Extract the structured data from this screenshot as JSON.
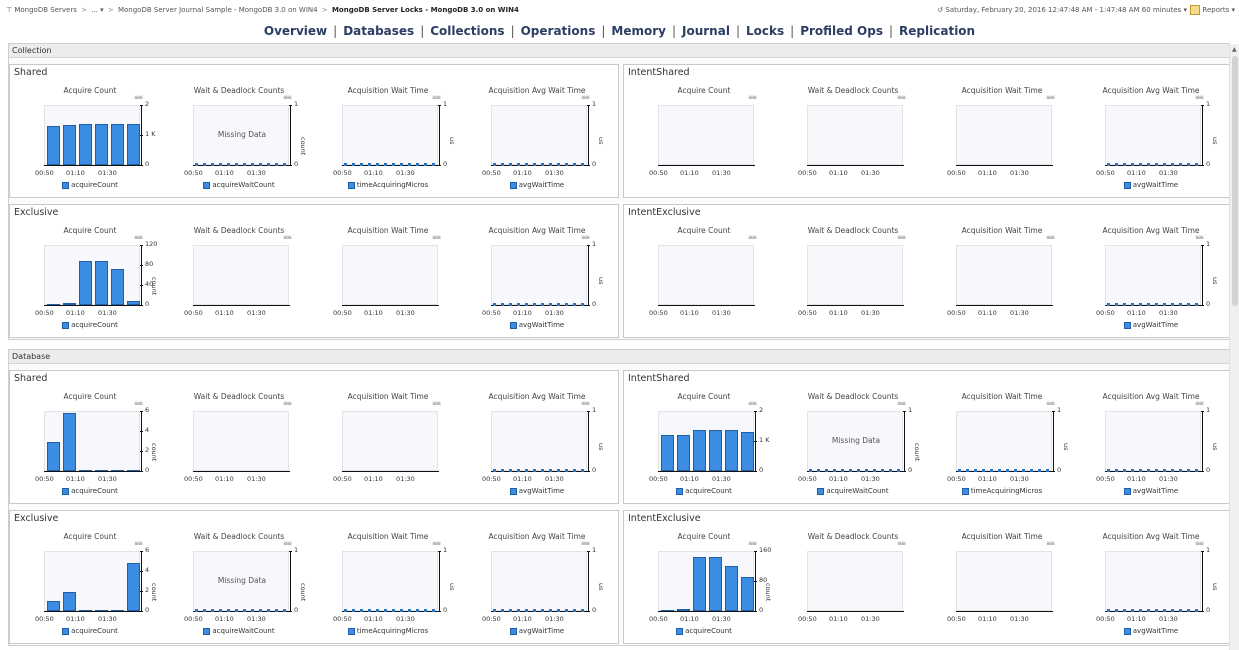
{
  "topbar": {
    "breadcrumb": [
      {
        "label": "MongoDB Servers"
      },
      {
        "label": "..."
      },
      {
        "label": "MongoDB Server Journal Sample - MongoDB 3.0 on WIN4"
      },
      {
        "label": "MongoDB Server Locks - MongoDB 3.0 on WIN4"
      }
    ],
    "time_range": "Saturday, February 20, 2016 12:47:48 AM - 1:47:48 AM 60 minutes",
    "reports_label": "Reports"
  },
  "nav": [
    {
      "label": "Overview"
    },
    {
      "label": "Databases"
    },
    {
      "label": "Collections"
    },
    {
      "label": "Operations"
    },
    {
      "label": "Memory"
    },
    {
      "label": "Journal"
    },
    {
      "label": "Locks"
    },
    {
      "label": "Profiled Ops"
    },
    {
      "label": "Replication"
    }
  ],
  "x_tick_labels": [
    "00:50",
    "01:10",
    "01:30"
  ],
  "sections": [
    {
      "title": "Collection",
      "panels": [
        {
          "title": "Shared",
          "charts": [
            {
              "title": "Acquire Count",
              "mode": "bars",
              "y_ticks": [
                "2",
                "1 K",
                "0"
              ],
              "ylim": [
                0,
                2000
              ],
              "values": [
                1350,
                1380,
                1400,
                1400,
                1400,
                1400
              ],
              "legend": "acquireCount"
            },
            {
              "title": "Wait & Deadlock Counts",
              "mode": "flat",
              "missing": "Missing Data",
              "y_ticks": [
                "1",
                "0"
              ],
              "ylabel": "count",
              "legend": "acquireWaitCount"
            },
            {
              "title": "Acquisition Wait Time",
              "mode": "flat",
              "y_ticks": [
                "1",
                "0"
              ],
              "ylabel": "us",
              "legend": "timeAcquiringMicros"
            },
            {
              "title": "Acquisition Avg Wait Time",
              "mode": "flat",
              "y_ticks": [
                "1",
                "0"
              ],
              "ylabel": "us",
              "legend": "avgWaitTime"
            }
          ]
        },
        {
          "title": "IntentShared",
          "charts": [
            {
              "title": "Acquire Count",
              "mode": "empty",
              "y_ticks": []
            },
            {
              "title": "Wait & Deadlock Counts",
              "mode": "empty",
              "y_ticks": []
            },
            {
              "title": "Acquisition Wait Time",
              "mode": "empty",
              "y_ticks": []
            },
            {
              "title": "Acquisition Avg Wait Time",
              "mode": "flat",
              "y_ticks": [
                "1",
                "0"
              ],
              "ylabel": "us",
              "legend": "avgWaitTime"
            }
          ]
        },
        {
          "title": "Exclusive",
          "charts": [
            {
              "title": "Acquire Count",
              "mode": "bars",
              "y_ticks": [
                "120",
                "80",
                "40",
                "0"
              ],
              "ylim": [
                0,
                120
              ],
              "values": [
                3,
                5,
                90,
                90,
                75,
                8
              ],
              "ylabel": "count",
              "legend": "acquireCount"
            },
            {
              "title": "Wait & Deadlock Counts",
              "mode": "empty",
              "y_ticks": []
            },
            {
              "title": "Acquisition Wait Time",
              "mode": "empty",
              "y_ticks": []
            },
            {
              "title": "Acquisition Avg Wait Time",
              "mode": "flat",
              "y_ticks": [
                "1",
                "0"
              ],
              "ylabel": "us",
              "legend": "avgWaitTime"
            }
          ]
        },
        {
          "title": "IntentExclusive",
          "charts": [
            {
              "title": "Acquire Count",
              "mode": "empty",
              "y_ticks": []
            },
            {
              "title": "Wait & Deadlock Counts",
              "mode": "empty",
              "y_ticks": []
            },
            {
              "title": "Acquisition Wait Time",
              "mode": "empty",
              "y_ticks": []
            },
            {
              "title": "Acquisition Avg Wait Time",
              "mode": "flat",
              "y_ticks": [
                "1",
                "0"
              ],
              "ylabel": "us",
              "legend": "avgWaitTime"
            }
          ]
        }
      ]
    },
    {
      "title": "Database",
      "panels": [
        {
          "title": "Shared",
          "charts": [
            {
              "title": "Acquire Count",
              "mode": "bars",
              "y_ticks": [
                "6",
                "4",
                "2",
                "0"
              ],
              "ylim": [
                0,
                6
              ],
              "values": [
                3,
                6,
                0,
                0,
                0,
                0
              ],
              "ylabel": "count",
              "legend": "acquireCount"
            },
            {
              "title": "Wait & Deadlock Counts",
              "mode": "empty",
              "y_ticks": []
            },
            {
              "title": "Acquisition Wait Time",
              "mode": "empty",
              "y_ticks": []
            },
            {
              "title": "Acquisition Avg Wait Time",
              "mode": "flat",
              "y_ticks": [
                "1",
                "0"
              ],
              "ylabel": "us",
              "legend": "avgWaitTime"
            }
          ]
        },
        {
          "title": "IntentShared",
          "charts": [
            {
              "title": "Acquire Count",
              "mode": "bars",
              "y_ticks": [
                "2",
                "1 K",
                "0"
              ],
              "ylim": [
                0,
                2000
              ],
              "values": [
                1250,
                1250,
                1420,
                1430,
                1420,
                1360
              ],
              "legend": "acquireCount"
            },
            {
              "title": "Wait & Deadlock Counts",
              "mode": "flat",
              "missing": "Missing Data",
              "y_ticks": [
                "1",
                "0"
              ],
              "ylabel": "count",
              "legend": "acquireWaitCount"
            },
            {
              "title": "Acquisition Wait Time",
              "mode": "flat",
              "y_ticks": [
                "1",
                "0"
              ],
              "ylabel": "us",
              "legend": "timeAcquiringMicros"
            },
            {
              "title": "Acquisition Avg Wait Time",
              "mode": "flat",
              "y_ticks": [
                "1",
                "0"
              ],
              "ylabel": "us",
              "legend": "avgWaitTime"
            }
          ]
        },
        {
          "title": "Exclusive",
          "charts": [
            {
              "title": "Acquire Count",
              "mode": "bars",
              "y_ticks": [
                "6",
                "4",
                "2",
                "0"
              ],
              "ylim": [
                0,
                6
              ],
              "values": [
                1,
                2,
                0,
                0,
                0,
                5
              ],
              "ylabel": "count",
              "legend": "acquireCount"
            },
            {
              "title": "Wait & Deadlock Counts",
              "mode": "flat",
              "missing": "Missing Data",
              "y_ticks": [
                "1",
                "0"
              ],
              "ylabel": "count",
              "legend": "acquireWaitCount"
            },
            {
              "title": "Acquisition Wait Time",
              "mode": "flat",
              "y_ticks": [
                "1",
                "0"
              ],
              "ylabel": "us",
              "legend": "timeAcquiringMicros"
            },
            {
              "title": "Acquisition Avg Wait Time",
              "mode": "flat",
              "y_ticks": [
                "1",
                "0"
              ],
              "ylabel": "us",
              "legend": "avgWaitTime"
            }
          ]
        },
        {
          "title": "IntentExclusive",
          "charts": [
            {
              "title": "Acquire Count",
              "mode": "bars",
              "y_ticks": [
                "160",
                "80",
                "0"
              ],
              "ylim": [
                0,
                160
              ],
              "values": [
                2,
                5,
                150,
                150,
                125,
                95
              ],
              "ylabel": "count",
              "legend": "acquireCount"
            },
            {
              "title": "Wait & Deadlock Counts",
              "mode": "empty",
              "y_ticks": []
            },
            {
              "title": "Acquisition Wait Time",
              "mode": "empty",
              "y_ticks": []
            },
            {
              "title": "Acquisition Avg Wait Time",
              "mode": "flat",
              "y_ticks": [
                "1",
                "0"
              ],
              "ylabel": "us",
              "legend": "avgWaitTime"
            }
          ]
        }
      ]
    }
  ]
}
